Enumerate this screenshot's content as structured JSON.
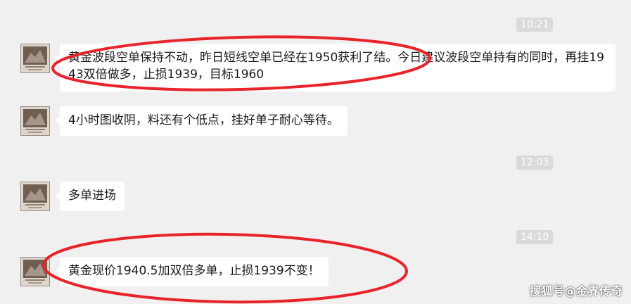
{
  "messages": [
    {
      "time": "10:21",
      "text": "黄金波段空单保持不动，昨日短线空单已经在1950获利了结。今日建议波段空单持有的同时，再挂1943双倍做多，止损1939，目标1960"
    },
    {
      "text": "4小时图收阴，料还有个低点，挂好单子耐心等待。"
    },
    {
      "time": "12:03",
      "text": "多单进场"
    },
    {
      "time": "14:10",
      "text": "黄金现价1940.5加双倍多单，止损1939不变！"
    }
  ],
  "watermark": "搜狐号@金界传奇",
  "colors": {
    "background": "#f0f0f0",
    "bubble": "#ffffff",
    "timestamp_bg": "#dadada",
    "annotation": "#e8232a"
  },
  "icons": [
    "avatar-image"
  ]
}
